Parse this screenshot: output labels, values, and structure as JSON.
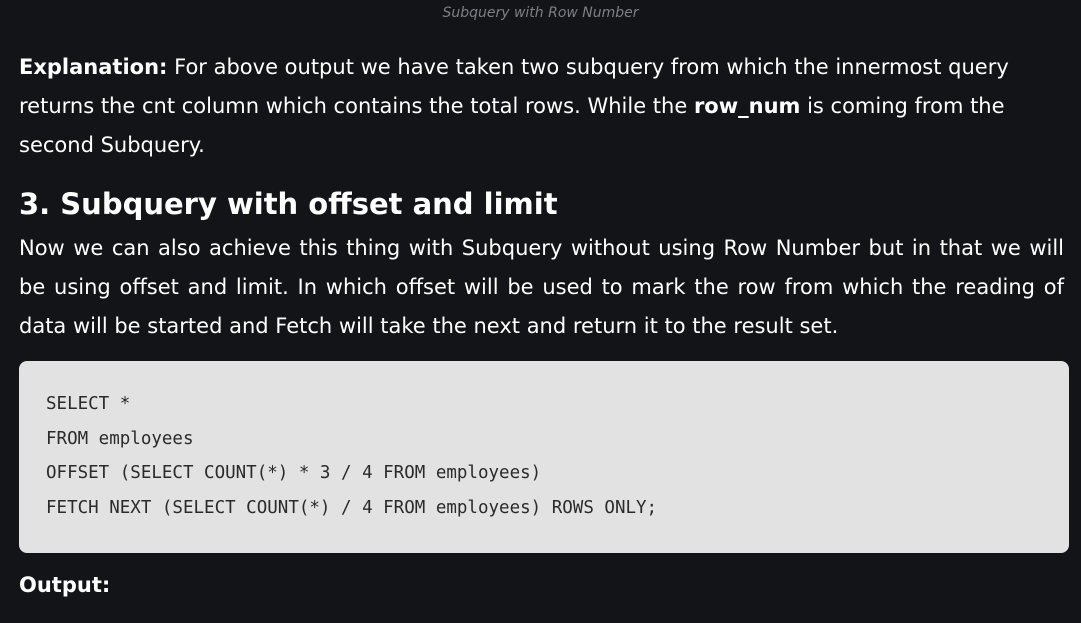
{
  "caption": "Subquery with Row Number",
  "explanation": {
    "label": "Explanation:",
    "text_before": " For above output we have taken two subquery from which the innermost query returns the cnt column which contains the total rows. While the ",
    "bold_term": "row_num",
    "text_after": " is coming from the second Subquery."
  },
  "section": {
    "heading": "3. Subquery with offset and limit",
    "intro": "Now we can also achieve this thing with Subquery without using Row Number but in that we will be using offset and limit. In which offset will be used to mark the row from which the reading of data will be started and Fetch will take the next and return it to the result set."
  },
  "code": {
    "lines": [
      "SELECT *",
      "FROM employees",
      "OFFSET (SELECT COUNT(*) * 3 / 4 FROM employees)",
      "FETCH NEXT (SELECT COUNT(*) / 4 FROM employees) ROWS ONLY;"
    ]
  },
  "output_label": "Output:"
}
